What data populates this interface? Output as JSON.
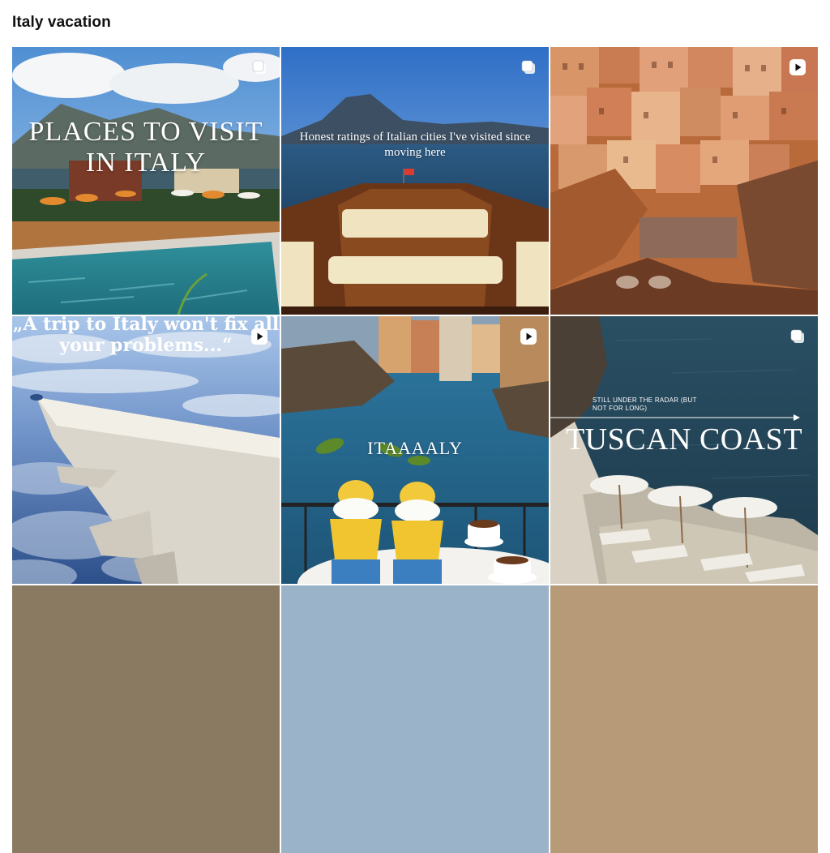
{
  "page": {
    "title": "Italy vacation"
  },
  "tiles": [
    {
      "text": "PLACES TO VISIT IN ITALY",
      "badge": "carousel-icon"
    },
    {
      "text": "Honest ratings of Italian cities I've visited since moving here",
      "badge": "carousel-icon"
    },
    {
      "text": "",
      "badge": "reel-play-icon"
    },
    {
      "text": "„A trip to Italy won't fix all your problems...“",
      "badge": "reel-play-icon"
    },
    {
      "text": "ITAAAALY",
      "badge": "reel-play-icon"
    },
    {
      "small_text": "STILL UNDER THE RADAR (BUT NOT FOR LONG)",
      "text": "TUSCAN COAST",
      "badge": "carousel-icon"
    }
  ],
  "colors": {
    "title": "#111111",
    "background": "#ffffff"
  }
}
